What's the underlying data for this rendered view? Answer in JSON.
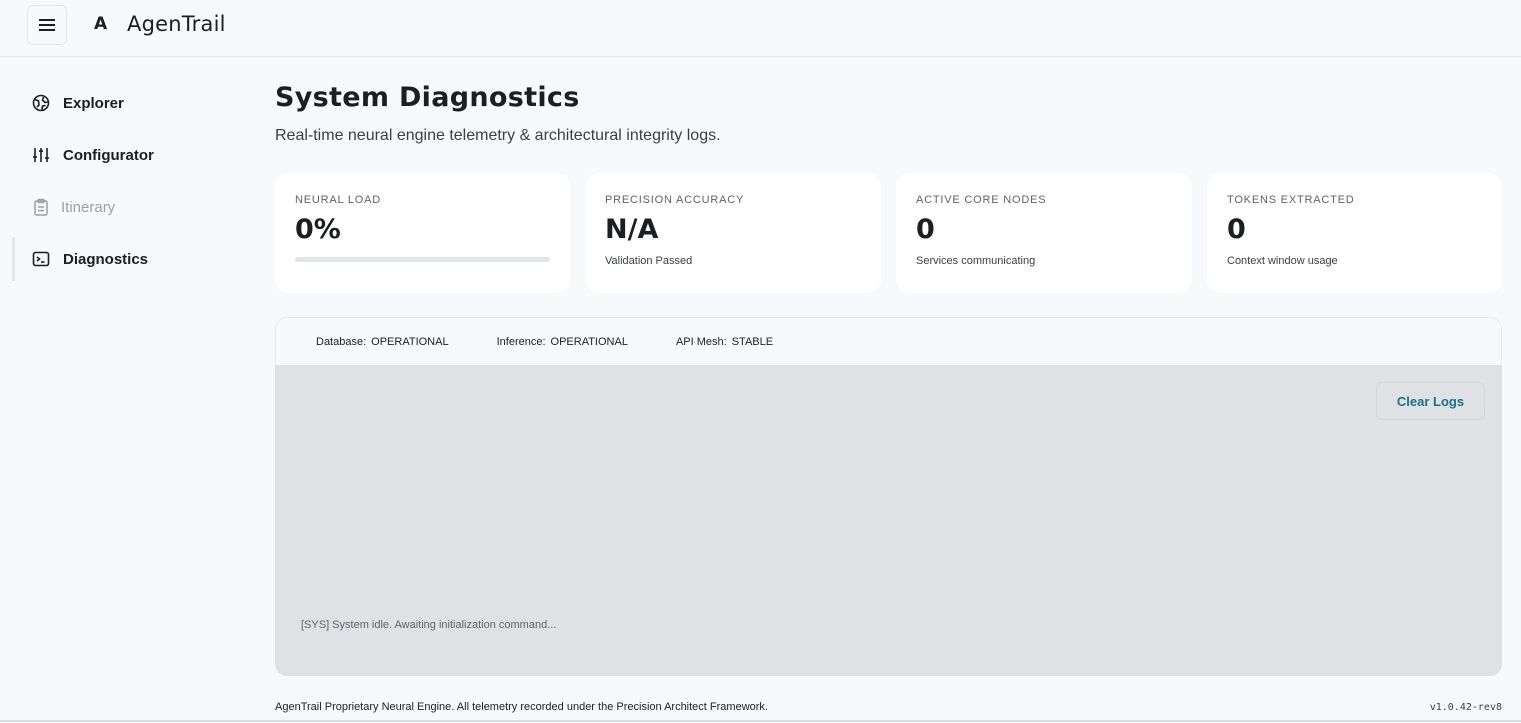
{
  "header": {
    "brand_mark": "A",
    "brand_name": "AgenTrail",
    "menu_icon": "hamburger-menu-icon"
  },
  "sidebar": {
    "items": [
      {
        "label": "Explorer",
        "icon": "globe-icon",
        "state": "normal"
      },
      {
        "label": "Configurator",
        "icon": "sliders-icon",
        "state": "normal"
      },
      {
        "label": "Itinerary",
        "icon": "clipboard-icon",
        "state": "disabled"
      },
      {
        "label": "Diagnostics",
        "icon": "terminal-icon",
        "state": "active"
      }
    ]
  },
  "main": {
    "title": "System Diagnostics",
    "subtitle": "Real-time neural engine telemetry & architectural integrity logs.",
    "cards": [
      {
        "label": "NEURAL LOAD",
        "value": "0%",
        "progress": 0
      },
      {
        "label": "PRECISION ACCURACY",
        "value": "N/A",
        "sub": "Validation Passed"
      },
      {
        "label": "ACTIVE CORE NODES",
        "value": "0",
        "sub": "Services communicating"
      },
      {
        "label": "TOKENS EXTRACTED",
        "value": "0",
        "sub": "Context window usage"
      }
    ],
    "status": [
      {
        "key": "Database:",
        "value": "OPERATIONAL"
      },
      {
        "key": "Inference:",
        "value": "OPERATIONAL"
      },
      {
        "key": "API Mesh:",
        "value": "STABLE"
      }
    ],
    "logs": {
      "clear_label": "Clear Logs",
      "lines": [
        "[SYS] System idle. Awaiting initialization command..."
      ]
    }
  },
  "footer": {
    "text": "AgenTrail Proprietary Neural Engine. All telemetry recorded under the Precision Architect Framework.",
    "version": "v1.0.42-rev8"
  },
  "colors": {
    "accent": "#1f6f84",
    "background": "#f8f9fa",
    "card": "#ffffff",
    "log_background": "#dfe2e5"
  }
}
